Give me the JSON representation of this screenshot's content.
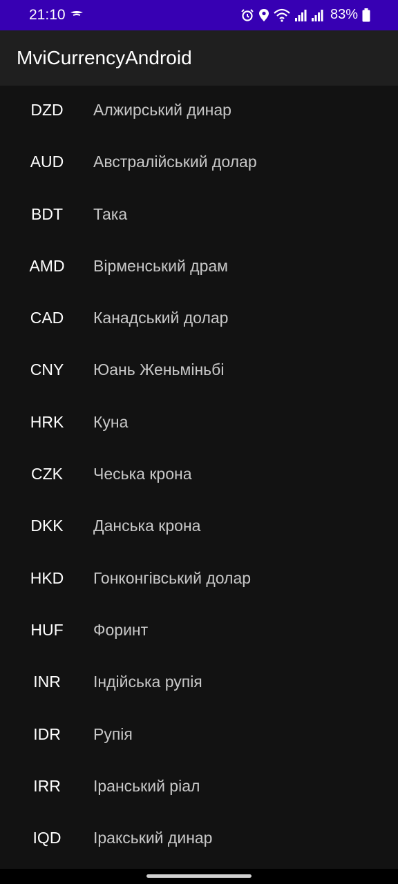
{
  "status_bar": {
    "time": "21:10",
    "battery": "83%",
    "icons": [
      "cast-icon",
      "alarm-icon",
      "location-icon",
      "wifi-icon",
      "signal-icon",
      "signal-icon",
      "battery-icon"
    ]
  },
  "app": {
    "title": "MviCurrencyAndroid"
  },
  "currencies": [
    {
      "code": "DZD",
      "name": "Алжирський динар"
    },
    {
      "code": "AUD",
      "name": "Австралійський долар"
    },
    {
      "code": "BDT",
      "name": "Така"
    },
    {
      "code": "AMD",
      "name": "Вірменський драм"
    },
    {
      "code": "CAD",
      "name": "Канадський долар"
    },
    {
      "code": "CNY",
      "name": "Юань Женьміньбі"
    },
    {
      "code": "HRK",
      "name": "Куна"
    },
    {
      "code": "CZK",
      "name": "Чеська крона"
    },
    {
      "code": "DKK",
      "name": "Данська крона"
    },
    {
      "code": "HKD",
      "name": "Гонконгівський долар"
    },
    {
      "code": "HUF",
      "name": "Форинт"
    },
    {
      "code": "INR",
      "name": "Індійська рупія"
    },
    {
      "code": "IDR",
      "name": "Рупія"
    },
    {
      "code": "IRR",
      "name": "Іранський ріал"
    },
    {
      "code": "IQD",
      "name": "Іракський динар"
    }
  ],
  "colors": {
    "status_bar": "#3700b3",
    "app_bar": "#1f1f1f",
    "background": "#121212",
    "code_text": "#ffffff",
    "name_text": "#c8c8c8"
  }
}
